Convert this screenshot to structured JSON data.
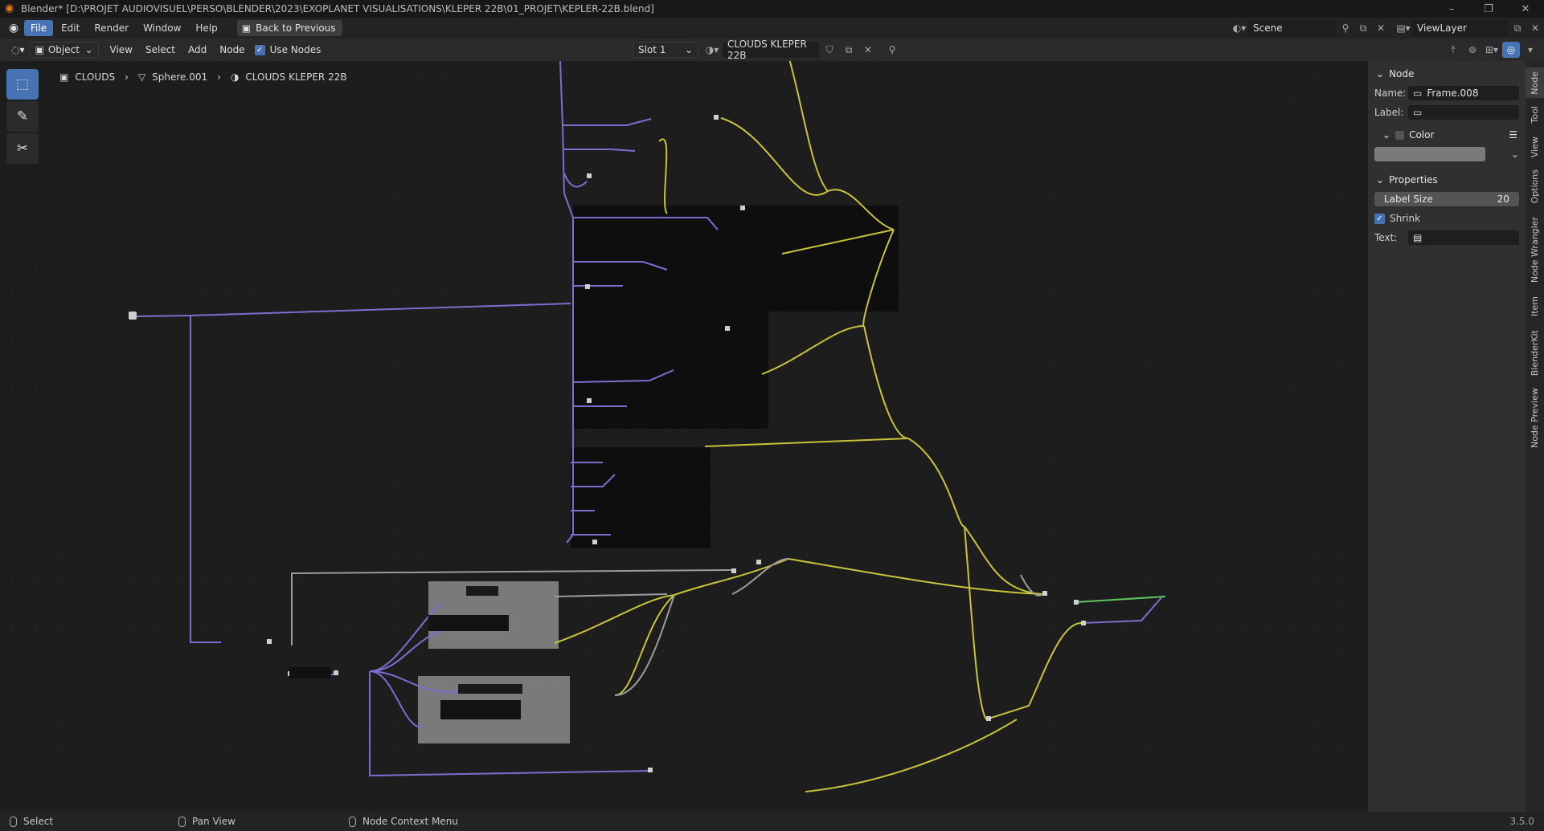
{
  "window": {
    "title": "Blender* [D:\\PROJET AUDIOVISUEL\\PERSO\\BLENDER\\2023\\EXOPLANET VISUALISATIONS\\KLEPER 22B\\01_PROJET\\KEPLER-22B.blend]",
    "minimize": "–",
    "maximize": "❐",
    "close": "✕"
  },
  "menubar": {
    "items": [
      "File",
      "Edit",
      "Render",
      "Window",
      "Help"
    ],
    "back_button": "Back to Previous",
    "scene": "Scene",
    "view_layer": "ViewLayer"
  },
  "editor_header": {
    "object_mode": "Object",
    "menus": [
      "View",
      "Select",
      "Add",
      "Node"
    ],
    "use_nodes_label": "Use Nodes",
    "slot": "Slot 1",
    "material": "CLOUDS KLEPER 22B"
  },
  "breadcrumb": {
    "object": "CLOUDS",
    "mesh": "Sphere.001",
    "material": "CLOUDS KLEPER 22B"
  },
  "sidebar": {
    "node_panel": "Node",
    "name_label": "Name:",
    "name_value": "Frame.008",
    "label_label": "Label:",
    "label_value": "",
    "color_label": "Color",
    "properties_panel": "Properties",
    "label_size_label": "Label Size",
    "label_size_value": "20",
    "shrink_label": "Shrink",
    "text_label": "Text:",
    "tabs": [
      "Node",
      "Tool",
      "View",
      "Options",
      "Node Wrangler",
      "Item",
      "BlenderKit",
      "Node Preview"
    ]
  },
  "statusbar": {
    "select": "Select",
    "pan_view": "Pan View",
    "context_menu": "Node Context Menu",
    "version": "3.5.0"
  },
  "colors": {
    "accent": "#4772b3",
    "link_shader": "#7a6fd1",
    "link_float": "#c9c33c",
    "link_color": "#9c9c9c",
    "link_output": "#5ec45e",
    "frame_dark": "#0e0e0e",
    "frame_gray": "#7a7a7a"
  }
}
